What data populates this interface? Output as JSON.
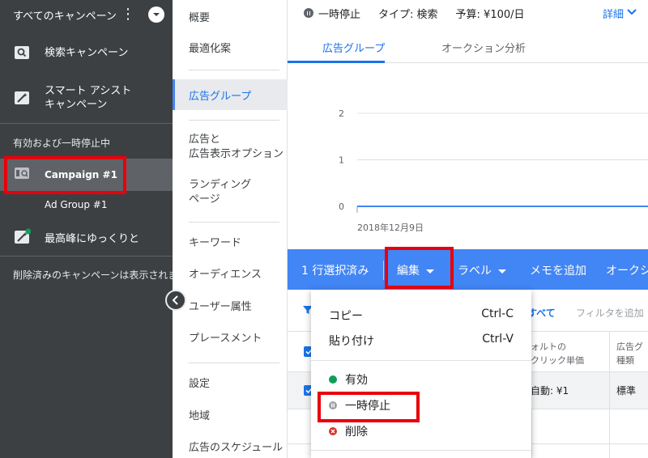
{
  "sidebar": {
    "title": "すべてのキャンペーン",
    "items": [
      {
        "label": "検索キャンペーン",
        "icon": "search-campaign-icon"
      },
      {
        "label": "スマート アシスト\nキャンペーン",
        "icon": "magic-wand-icon"
      }
    ],
    "section_label": "有効および一時停止中",
    "campaign": "Campaign #1",
    "ad_group": "Ad Group #1",
    "peak_item": "最高峰にゆっくりと",
    "deleted_note": "削除済みのキャンペーンは表示されま"
  },
  "subnav": {
    "items": [
      "概要",
      "最適化案",
      "広告グループ",
      "広告と\n広告表示オプション",
      "ランディング\nページ",
      "キーワード",
      "オーディエンス",
      "ユーザー属性",
      "プレースメント",
      "設定",
      "地域",
      "広告のスケジュール"
    ],
    "active": "広告グループ"
  },
  "topbar": {
    "status": "一時停止",
    "type": "タイプ: 検索",
    "budget": "予算: ¥100/日",
    "detail": "詳細"
  },
  "tabs": [
    {
      "label": "広告グループ",
      "active": true
    },
    {
      "label": "オークション分析",
      "active": false
    }
  ],
  "chart_data": {
    "type": "line",
    "x": [
      "2018年12月9日"
    ],
    "series": [
      {
        "values": [
          0
        ]
      }
    ],
    "y_ticks": [
      "2",
      "1",
      "0"
    ],
    "ylim": [
      0,
      2
    ],
    "x_label_start": "2018年12月9日",
    "color": "#4285f4"
  },
  "actionbar": {
    "selected": "1 行選択済み",
    "edit": "編集",
    "label": "ラベル",
    "memo": "メモを追加",
    "auction": "オークシ"
  },
  "filter": {
    "all": "すべて",
    "add_placeholder": "フィルタを追加"
  },
  "table": {
    "headers": [
      "ォルトの\nクリック単価",
      "広告グ\n種類"
    ],
    "rows": [
      [
        "自動: ¥1",
        "標準"
      ]
    ]
  },
  "menu": {
    "copy": "コピー",
    "copy_shortcut": "Ctrl-C",
    "paste": "貼り付け",
    "paste_shortcut": "Ctrl-V",
    "enable": "有効",
    "pause": "一時停止",
    "remove": "削除"
  },
  "colors": {
    "accent": "#4285f4",
    "enabled": "#0f9d58",
    "paused": "#9aa0a6",
    "removed": "#d93025",
    "highlight": "#e8000b"
  }
}
